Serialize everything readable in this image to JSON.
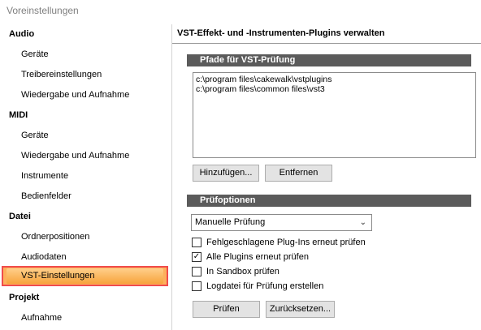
{
  "window": {
    "title": "Voreinstellungen"
  },
  "sidebar": {
    "items": [
      {
        "label": "Audio",
        "kind": "category"
      },
      {
        "label": "Geräte",
        "kind": "item"
      },
      {
        "label": "Treibereinstellungen",
        "kind": "item"
      },
      {
        "label": "Wiedergabe und Aufnahme",
        "kind": "item"
      },
      {
        "label": "MIDI",
        "kind": "category"
      },
      {
        "label": "Geräte",
        "kind": "item"
      },
      {
        "label": "Wiedergabe und Aufnahme",
        "kind": "item"
      },
      {
        "label": "Instrumente",
        "kind": "item"
      },
      {
        "label": "Bedienfelder",
        "kind": "item"
      },
      {
        "label": "Datei",
        "kind": "category"
      },
      {
        "label": "Ordnerpositionen",
        "kind": "item"
      },
      {
        "label": "Audiodaten",
        "kind": "item"
      },
      {
        "label": "VST-Einstellungen",
        "kind": "item",
        "selected": true
      },
      {
        "label": "Projekt",
        "kind": "category"
      },
      {
        "label": "Aufnahme",
        "kind": "item"
      }
    ]
  },
  "page": {
    "header": "VST-Effekt- und -Instrumenten-Plugins verwalten",
    "paths_section": "Pfade für VST-Prüfung",
    "paths": [
      "c:\\program files\\cakewalk\\vstplugins",
      "c:\\program files\\common files\\vst3"
    ],
    "add_button": "Hinzufügen...",
    "remove_button": "Entfernen",
    "options_section": "Prüfoptionen",
    "scan_mode": "Manuelle Prüfung",
    "options": [
      {
        "label": "Fehlgeschlagene Plug-Ins erneut prüfen",
        "checked": false
      },
      {
        "label": "Alle Plugins erneut prüfen",
        "checked": true
      },
      {
        "label": "In Sandbox prüfen",
        "checked": false
      },
      {
        "label": "Logdatei für Prüfung erstellen",
        "checked": false
      }
    ],
    "scan_button": "Prüfen",
    "reset_button": "Zurücksetzen..."
  },
  "colors": {
    "section_bar": "#5b5b5b",
    "selection_fill": "#fdb05d",
    "selection_outline": "#f04c4c"
  }
}
